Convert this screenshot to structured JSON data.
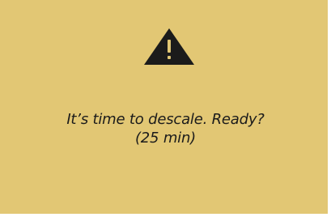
{
  "dialog": {
    "icon": "warning-icon",
    "message_line1": "It’s time to descale. Ready?",
    "message_line2": "(25 min)"
  },
  "colors": {
    "background": "#e2c774",
    "icon": "#1b1b1b",
    "text": "#1b1b1b"
  }
}
